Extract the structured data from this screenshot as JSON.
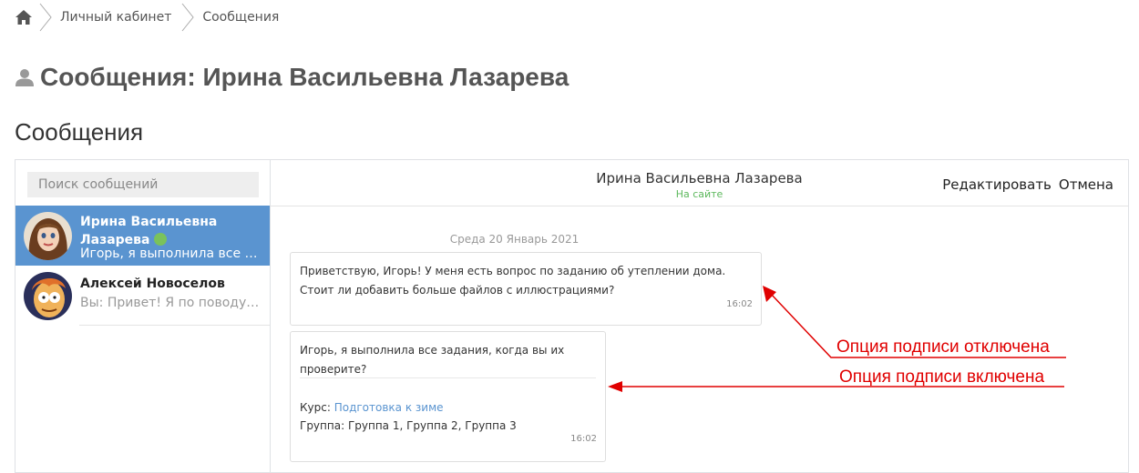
{
  "breadcrumb": {
    "home_icon": "home-icon",
    "items": [
      "Личный кабинет",
      "Сообщения"
    ]
  },
  "page": {
    "title": "Сообщения: Ирина Васильевна Лазарева",
    "title_icon": "user-icon",
    "section_title": "Сообщения"
  },
  "search": {
    "placeholder": "Поиск сообщений"
  },
  "conversations": [
    {
      "name_line1": "Ирина Васильевна",
      "name_line2": "Лазарева",
      "online": true,
      "preview": "Игорь, я выполнила все задания, когда вы их проверите?"
    },
    {
      "name": "Алексей Новоселов",
      "preview": "Вы: Привет! Я по поводу курса"
    }
  ],
  "chat": {
    "name": "Ирина Васильевна Лазарева",
    "status": "На сайте",
    "edit_label": "Редактировать",
    "cancel_label": "Отмена",
    "date": "Среда 20 Январь 2021",
    "messages": [
      {
        "text": "Приветствую, Игорь! У меня есть вопрос по заданию об утеплении дома. Стоит ли добавить больше файлов с иллюстрациями?",
        "time": "16:02"
      },
      {
        "text": "Игорь, я выполнила все задания, когда вы их проверите?",
        "course_label": "Курс:",
        "course_link": "Подготовка к зиме",
        "group_line": "Группа: Группа 1, Группа 2, Группа 3",
        "time": "16:02"
      }
    ]
  },
  "annotations": {
    "signature_off": "Опция подписи отключена",
    "signature_on": "Опция подписи включена"
  },
  "colors": {
    "active_conversation": "#5a94d0",
    "online": "#7ac25b",
    "status_text": "#5cb85c",
    "annotation": "#e00000",
    "link": "#5a94d0"
  }
}
